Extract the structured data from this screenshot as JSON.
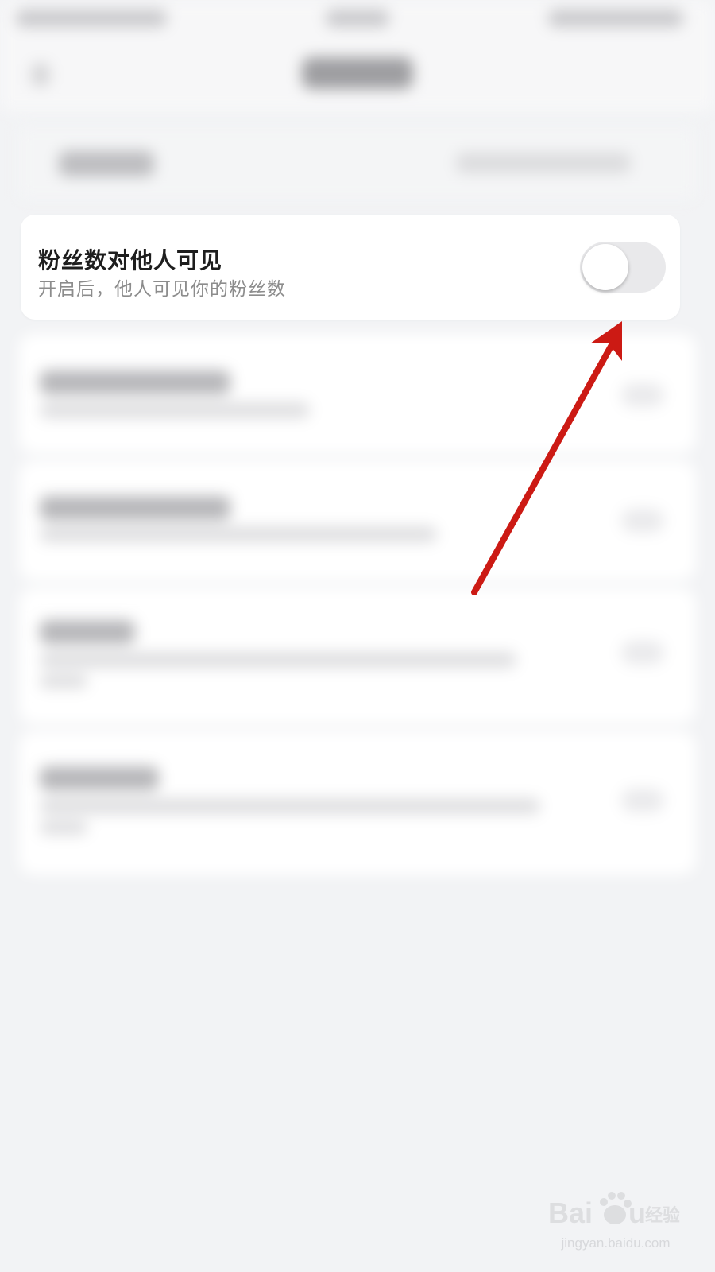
{
  "setting": {
    "title": "粉丝数对他人可见",
    "description": "开启后，他人可见你的粉丝数",
    "toggle_on": false
  },
  "annotation": {
    "arrow_color": "#cc1a14"
  },
  "watermark": {
    "brand": "Bai du 经验",
    "url": "jingyan.baidu.com"
  },
  "colors": {
    "background": "#f2f3f5",
    "card": "#ffffff",
    "title_text": "#1e1e1e",
    "desc_text": "#8c8c8c",
    "toggle_off_track": "#e9e9eb"
  }
}
